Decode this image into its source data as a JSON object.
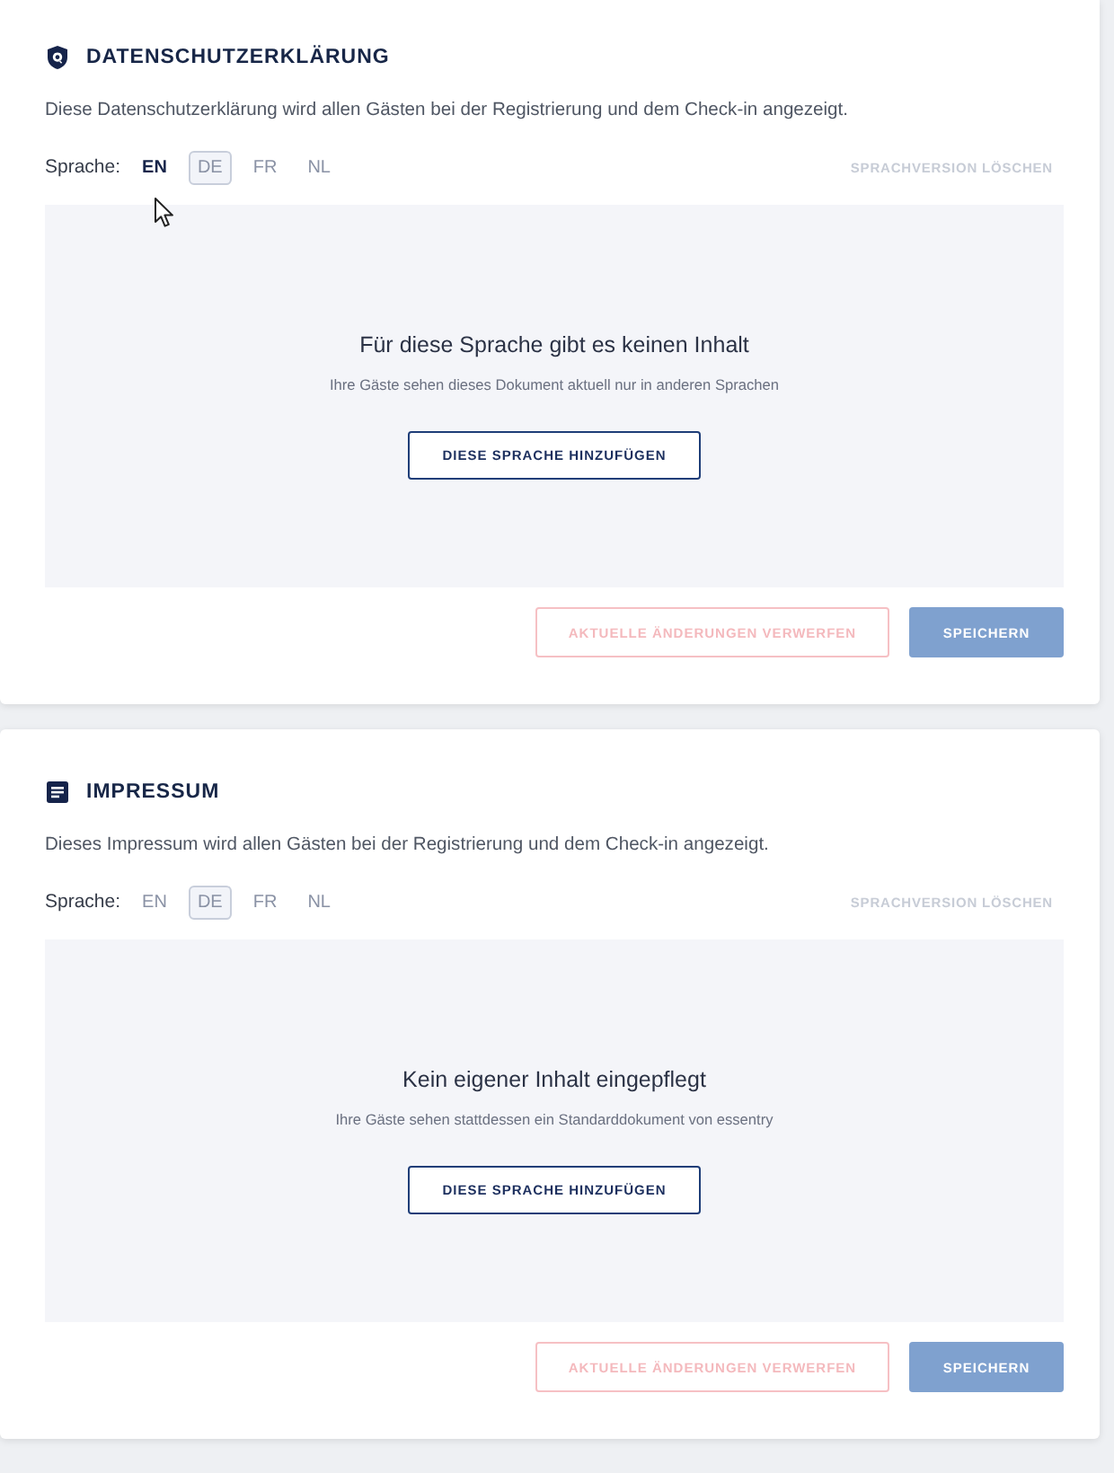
{
  "sections": [
    {
      "kind": "shield",
      "title": "DATENSCHUTZERKLÄRUNG",
      "description": "Diese Datenschutzerklärung wird allen Gästen bei der Registrierung und dem Check-in angezeigt.",
      "language_label": "Sprache:",
      "languages": [
        {
          "code": "EN",
          "selected": false,
          "hovered": true
        },
        {
          "code": "DE",
          "selected": true,
          "hovered": false
        },
        {
          "code": "FR",
          "selected": false,
          "hovered": false
        },
        {
          "code": "NL",
          "selected": false,
          "hovered": false
        }
      ],
      "delete_version": {
        "label": "SPRACHVERSION LÖSCHEN",
        "disabled": true
      },
      "empty_state": {
        "heading": "Für diese Sprache gibt es keinen Inhalt",
        "text": "Ihre Gäste sehen dieses Dokument aktuell nur in anderen Sprachen",
        "add_button": "DIESE SPRACHE HINZUFÜGEN"
      },
      "discard_button": {
        "label": "AKTUELLE ÄNDERUNGEN VERWERFEN",
        "disabled": true
      },
      "save_button": {
        "label": "SPEICHERN",
        "disabled": true
      }
    },
    {
      "kind": "document",
      "title": "IMPRESSUM",
      "description": "Dieses Impressum wird allen Gästen bei der Registrierung und dem Check-in angezeigt.",
      "language_label": "Sprache:",
      "languages": [
        {
          "code": "EN",
          "selected": false,
          "hovered": false
        },
        {
          "code": "DE",
          "selected": true,
          "hovered": false
        },
        {
          "code": "FR",
          "selected": false,
          "hovered": false
        },
        {
          "code": "NL",
          "selected": false,
          "hovered": false
        }
      ],
      "delete_version": {
        "label": "SPRACHVERSION LÖSCHEN",
        "disabled": true
      },
      "empty_state": {
        "heading": "Kein eigener Inhalt eingepflegt",
        "text": "Ihre Gäste sehen stattdessen ein Standarddokument von essentry",
        "add_button": "DIESE SPRACHE HINZUFÜGEN"
      },
      "discard_button": {
        "label": "AKTUELLE ÄNDERUNGEN VERWERFEN",
        "disabled": true
      },
      "save_button": {
        "label": "SPEICHERN",
        "disabled": true
      }
    }
  ]
}
